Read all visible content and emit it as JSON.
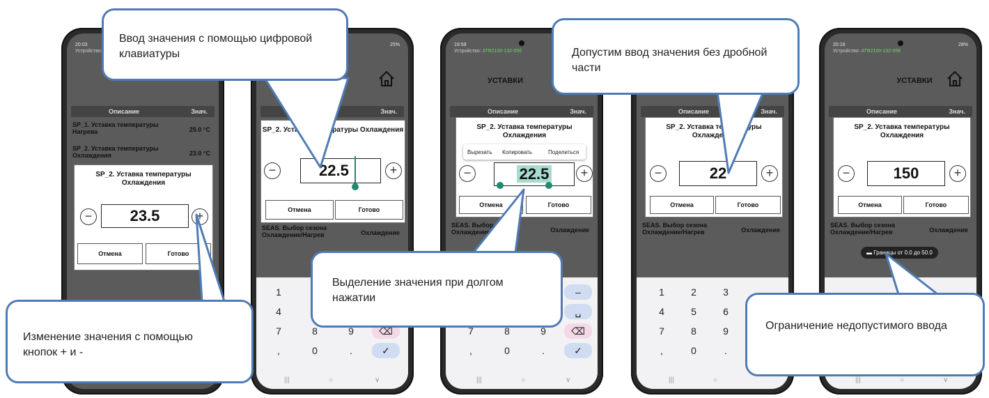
{
  "common": {
    "device_label": "Устройство:",
    "device_id": "АТВ2100-132-056",
    "screen_title": "УСТАВКИ",
    "col_desc": "Описание",
    "col_val": "Знач.",
    "dialog_title": "SP_2. Уставка температуры Охлаждения",
    "btn_cancel": "Отмена",
    "btn_done": "Готово",
    "row_season": "SEAS. Выбор сезона Охлаждение/Нагрев",
    "row_season_val": "Охлаждение"
  },
  "phone1": {
    "time": "20:03",
    "row1_desc": "SP_1. Уставка температуры Нагрева",
    "row1_val": "25.0 °C",
    "row2_desc": "SP_2. Уставка температуры Охлаждения",
    "row2_val": "23.0 °C",
    "value": "23.5"
  },
  "phone2": {
    "status": "25%",
    "value": "22.5"
  },
  "phone3": {
    "time": "19:59",
    "value": "22.5",
    "menu_cut": "Вырезать",
    "menu_copy": "Копировать",
    "menu_share": "Поделиться"
  },
  "phone4": {
    "value": "22"
  },
  "phone5": {
    "time": "20:16",
    "status": "28%",
    "value": "150",
    "toast": "Границы от 0.0 до 50.0"
  },
  "keyboard": {
    "r1": [
      "1",
      "2",
      "3",
      "–"
    ],
    "r2": [
      "4",
      "5",
      "6",
      "␣"
    ],
    "r3": [
      "7",
      "8",
      "9",
      "⌫"
    ],
    "r4": [
      ",",
      "0",
      ".",
      "✓"
    ]
  },
  "callouts": {
    "c1": "Ввод значения с помощью цифровой клавиатуры",
    "c2": "Изменение значения с помощью кнопок + и -",
    "c3": "Выделение значения при долгом нажатии",
    "c4": "Допустим ввод значения без дробной части",
    "c5": "Ограничение недопустимого ввода"
  },
  "colors": {
    "callout_border": "#4f7bb5",
    "selection": "#a8dcd1",
    "handle": "#1e8a6e"
  }
}
